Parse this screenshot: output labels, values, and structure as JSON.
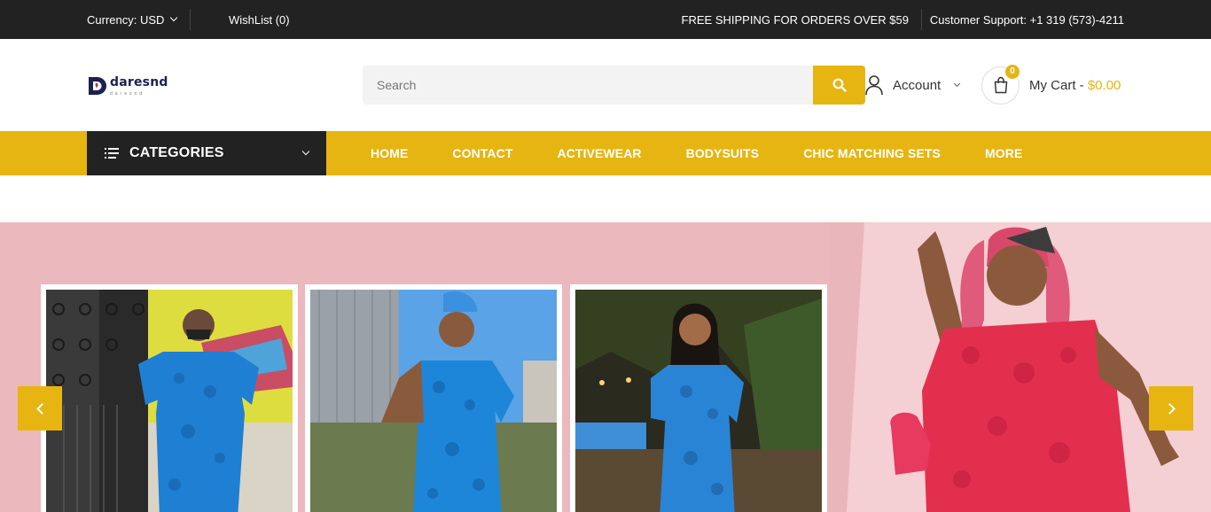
{
  "topbar": {
    "currency_label": "Currency: USD",
    "wishlist_label": "WishList (0)",
    "shipping_text": "FREE SHIPPING FOR ORDERS OVER $59",
    "support_text": "Customer Support: +1 319 (573)-4211"
  },
  "header": {
    "logo_text": "daresnd",
    "logo_sub": "daresnd",
    "search_placeholder": "Search",
    "account_label": "Account",
    "cart_count": "0",
    "cart_label": "My Cart -",
    "cart_total": "$0.00"
  },
  "nav": {
    "categories_label": "CATEGORIES",
    "items": [
      "HOME",
      "CONTACT",
      "ACTIVEWEAR",
      "BODYSUITS",
      "CHIC MATCHING SETS",
      "MORE"
    ]
  },
  "colors": {
    "accent": "#e6b511",
    "dark": "#222222",
    "hero_bg": "#ebb8bd"
  },
  "icons": [
    "chevron-down-icon",
    "search-icon",
    "user-icon",
    "shopping-bag-icon",
    "menu-lines-icon",
    "chevron-left-icon",
    "chevron-right-icon"
  ]
}
